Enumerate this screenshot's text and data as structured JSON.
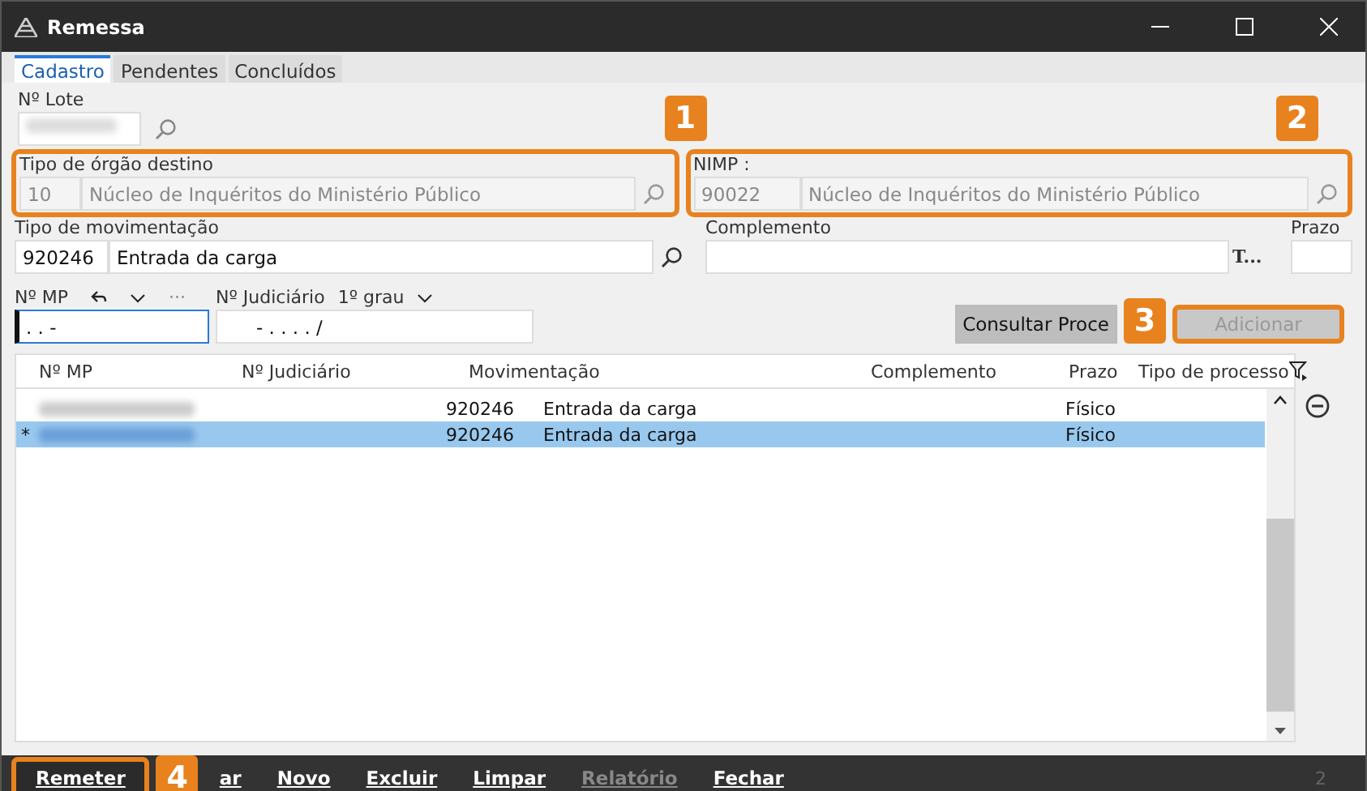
{
  "window": {
    "title": "Remessa"
  },
  "tabs": [
    {
      "label": "Cadastro",
      "selected": true
    },
    {
      "label": "Pendentes",
      "selected": false
    },
    {
      "label": "Concluídos",
      "selected": false
    }
  ],
  "lote": {
    "label": "Nº Lote"
  },
  "orgao": {
    "label": "Tipo de órgão destino",
    "code": "10",
    "description": "Núcleo de Inquéritos do Ministério Público",
    "disabled": true,
    "badge": "1"
  },
  "nimp": {
    "label": "NIMP :",
    "code": "90022",
    "description": "Núcleo de Inquéritos do Ministério Público",
    "disabled": true,
    "badge": "2"
  },
  "movimentacao": {
    "label": "Tipo de movimentação",
    "code": "920246",
    "description": "Entrada da carga"
  },
  "complemento": {
    "label": "Complemento",
    "suffix": "T..."
  },
  "prazo": {
    "label": "Prazo"
  },
  "mp": {
    "label": "Nº MP",
    "more": "···",
    "value": ".  .       -"
  },
  "judiciario": {
    "label": "Nº Judiciário",
    "grau": "1º grau",
    "value": "-  .  .  .  .     /"
  },
  "consultar": {
    "label": "Consultar Proce"
  },
  "adicionar": {
    "label": "Adicionar",
    "disabled": true,
    "badge": "3"
  },
  "table": {
    "columns": [
      "Nº MP",
      "Nº Judiciário",
      "Movimentação",
      "Complemento",
      "Prazo",
      "Tipo de processo"
    ],
    "rows": [
      {
        "marker": "",
        "code": "920246",
        "movimentacao": "Entrada da carga",
        "tipo": "Físico",
        "selected": false
      },
      {
        "marker": "*",
        "code": "920246",
        "movimentacao": "Entrada da carga",
        "tipo": "Físico",
        "selected": true
      }
    ]
  },
  "footer": {
    "buttons": [
      {
        "label": "Remeter",
        "disabled": false,
        "badge": "4"
      },
      {
        "label": "ar",
        "disabled": false
      },
      {
        "label": "Novo",
        "disabled": false
      },
      {
        "label": "Excluir",
        "disabled": false
      },
      {
        "label": "Limpar",
        "disabled": false
      },
      {
        "label": "Relatório",
        "disabled": true
      },
      {
        "label": "Fechar",
        "disabled": false
      }
    ],
    "page": "2"
  }
}
